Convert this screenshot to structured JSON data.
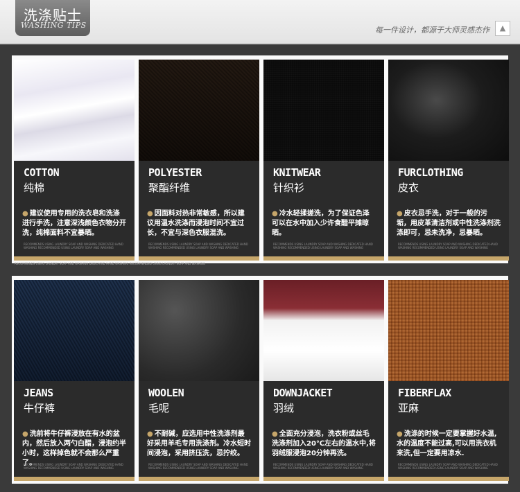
{
  "header": {
    "title_cn": "洗涤贴士",
    "title_en": "WASHING TIPS",
    "slogan": "每一件设计，都源于大师灵感杰作",
    "toggle_glyph": "▲"
  },
  "accent_color": "#c6a66a",
  "bullet_glyph": "●",
  "footer_fine_text": "RECOMMENDS USING LAUNDRY SOAP AND WASHING DEDICATED HAND WASHING RECOMMENDED USING LAUNDRY SOAP AND WASHING",
  "cards": [
    {
      "en": "COTTON",
      "cn": "纯棉",
      "note": "建议使用专用的洗衣皂和洗涤进行手洗，注意深浅颜色衣物分开洗，纯棉面料不宜暴晒。",
      "fine": "RECOMMENDS USING LAUNDRY SOAP AND WASHING DEDICATED HAND WASHING RECOMMENDED USING LAUNDRY SOAP AND WASHING",
      "texture": "white-satin"
    },
    {
      "en": "POLYESTER",
      "cn": "聚酯纤维",
      "note": "因面料对热非常敏感，所以建议用温水洗涤而浸泡时间不宜过长，不宜与深色衣服混洗。",
      "fine": "RECOMMENDS USING LAUNDRY SOAP AND WASHING DEDICATED HAND WASHING RECOMMENDED USING LAUNDRY SOAP AND WASHING",
      "texture": "brown-twill"
    },
    {
      "en": "KNITWEAR",
      "cn": "针织衫",
      "note": "冷水轻揉搓洗，为了保证色泽可以在水中加入少许食醋平摊晾晒。",
      "fine": "RECOMMENDS USING LAUNDRY SOAP AND WASHING DEDICATED HAND WASHING RECOMMENDED USING LAUNDRY SOAP AND WASHING",
      "texture": "dark-knit"
    },
    {
      "en": "FURCLOTHING",
      "cn": "皮衣",
      "note": "皮衣忌手洗，对于一般的污垢，用皮革清洁剂或中性洗涤剂洗涤即可，忌未洗净，忌暴晒。",
      "fine": "RECOMMENDS USING LAUNDRY SOAP AND WASHING DEDICATED HAND WASHING RECOMMENDED USING LAUNDRY SOAP AND WASHING",
      "texture": "black-leather"
    },
    {
      "en": "JEANS",
      "cn": "牛仔裤",
      "note": "洗前将牛仔裤浸放在有水的盆内，然后放入两勺白醋，浸泡约半小时，这样掉色就不会那么严重了。",
      "fine": "RECOMMENDS USING LAUNDRY SOAP AND WASHING DEDICATED HAND WASHING RECOMMENDED USING LAUNDRY SOAP AND WASHING",
      "texture": "blue-denim"
    },
    {
      "en": "WOOLEN",
      "cn": "毛呢",
      "note": "不耐碱，应选用中性洗涤剂最好采用羊毛专用洗涤剂。冷水短时间浸泡，采用挤压洗，忌拧绞。",
      "fine": "RECOMMENDS USING LAUNDRY SOAP AND WASHING DEDICATED HAND WASHING RECOMMENDED USING LAUNDRY SOAP AND WASHING",
      "texture": "grey-wool"
    },
    {
      "en": "DOWNJACKET",
      "cn": "羽绒",
      "note": "全面充分浸泡，洗衣粉或丝毛洗涤剂加入20℃左右的温水中,将羽绒服浸泡20分钟再洗。",
      "fine": "RECOMMENDS USING LAUNDRY SOAP AND WASHING DEDICATED HAND WASHING RECOMMENDED USING LAUNDRY SOAP AND WASHING",
      "texture": "white-down"
    },
    {
      "en": "FIBERFLAX",
      "cn": "亚麻",
      "note": "洗涤的时候一定要掌握好水温,水的温度不能过高,可以用洗衣机来洗,但一定要用凉水.",
      "fine": "RECOMMENDS USING LAUNDRY SOAP AND WASHING DEDICATED HAND WASHING RECOMMENDED USING LAUNDRY SOAP AND WASHING",
      "texture": "tan-linen"
    }
  ]
}
